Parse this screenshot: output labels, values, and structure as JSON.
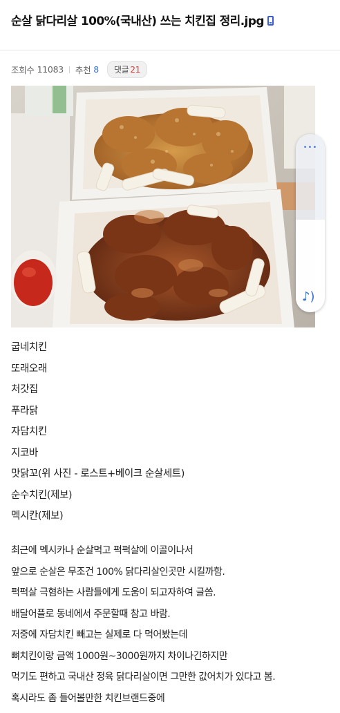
{
  "post": {
    "title": "순살 닭다리살 100%(국내산) 쓰는 치킨집 정리.jpg",
    "views_label": "조회수",
    "views": "11083",
    "recommend_label": "추천",
    "recommend": "8",
    "comment_label": "댓글",
    "comment_count": "21"
  },
  "image": {
    "description_icon": "chicken-photo",
    "volume_icon": "music-note-icon",
    "volume_level": 0.52
  },
  "shop_list": [
    "굽네치킨",
    "또래오래",
    "처갓집",
    "푸라닭",
    "자담치킨",
    "지코바",
    "맛닭꼬(위 사진 - 로스트+베이크 순살세트)",
    "순수치킨(제보)",
    "멕시칸(제보)"
  ],
  "paragraph": [
    "최근에 멕시카나 순살먹고 퍽퍽살에 이골이나서",
    "앞으로 순살은 무조건 100% 닭다리살인곳만 시킬까함.",
    "퍽퍽살 극혐하는 사람들에게 도움이 되고자하여 글씀.",
    "배달어플로 동네에서 주문할때 참고 바람.",
    "저중에 자담치킨 빼고는 실제로 다 먹어봤는데",
    "뼈치킨이랑 금액 1000원~3000원까지 차이나긴하지만",
    "먹기도 편하고 국내산 정육 닭다리살이면 그만한 값어치가 있다고 봄.",
    "혹시라도 좀 들어볼만한 치킨브랜드중에"
  ],
  "colors": {
    "accent_blue": "#2f76d8",
    "comment_red": "#e03a3a",
    "divider": "#e6e6e6"
  }
}
